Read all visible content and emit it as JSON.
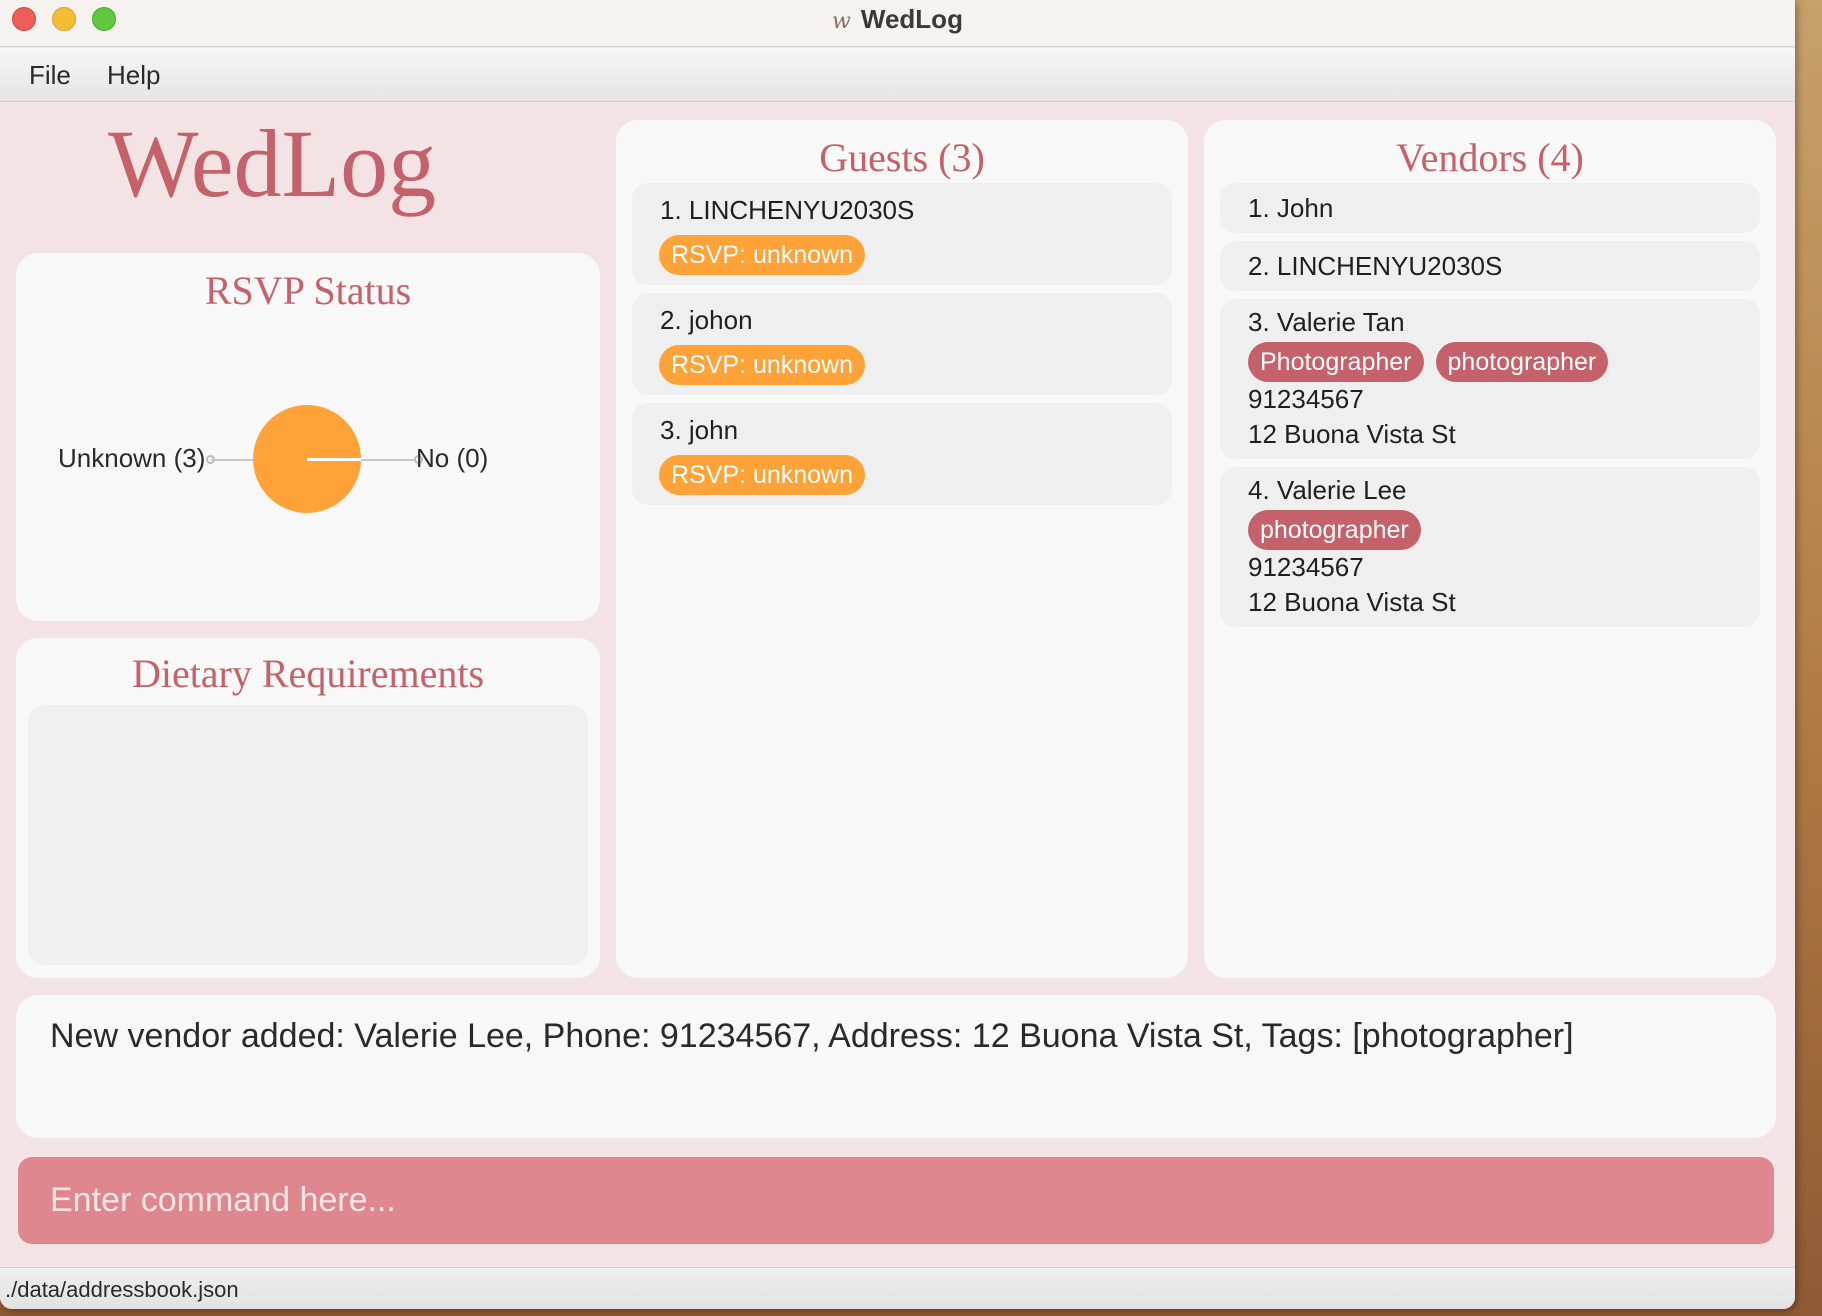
{
  "window": {
    "title": "WedLog",
    "title_glyph": "w"
  },
  "menu": {
    "file": "File",
    "help": "Help"
  },
  "logo": {
    "text": "WedLog"
  },
  "rsvp": {
    "title": "RSVP Status",
    "unknown_label": "Unknown (3)",
    "no_label": "No (0)",
    "pie_color": "#ffa237"
  },
  "dietary": {
    "title": "Dietary Requirements"
  },
  "guests": {
    "title": "Guests (3)",
    "items": [
      {
        "name": "1.  LINCHENYU2030S",
        "rsvp": "RSVP: unknown"
      },
      {
        "name": "2.  johon",
        "rsvp": "RSVP: unknown"
      },
      {
        "name": "3.  john",
        "rsvp": "RSVP: unknown"
      }
    ]
  },
  "vendors": {
    "title": "Vendors (4)",
    "items": [
      {
        "name": "1.  John"
      },
      {
        "name": "2.  LINCHENYU2030S"
      },
      {
        "name": "3.  Valerie Tan",
        "tags": [
          "Photographer",
          "photographer"
        ],
        "phone": "91234567",
        "address": "12 Buona Vista St"
      },
      {
        "name": "4.  Valerie Lee",
        "tags": [
          "photographer"
        ],
        "phone": "91234567",
        "address": "12 Buona Vista St"
      }
    ]
  },
  "result": {
    "text": "New vendor added: Valerie Lee, Phone: 91234567, Address: 12 Buona Vista St, Tags: [photographer]"
  },
  "command": {
    "placeholder": "Enter command here..."
  },
  "status": {
    "path": "./data/addressbook.json"
  },
  "colors": {
    "accent": "#c4616b",
    "rsvp_unknown": "#ffa237",
    "command_bg": "#de878e",
    "background": "#f3e3e4"
  }
}
